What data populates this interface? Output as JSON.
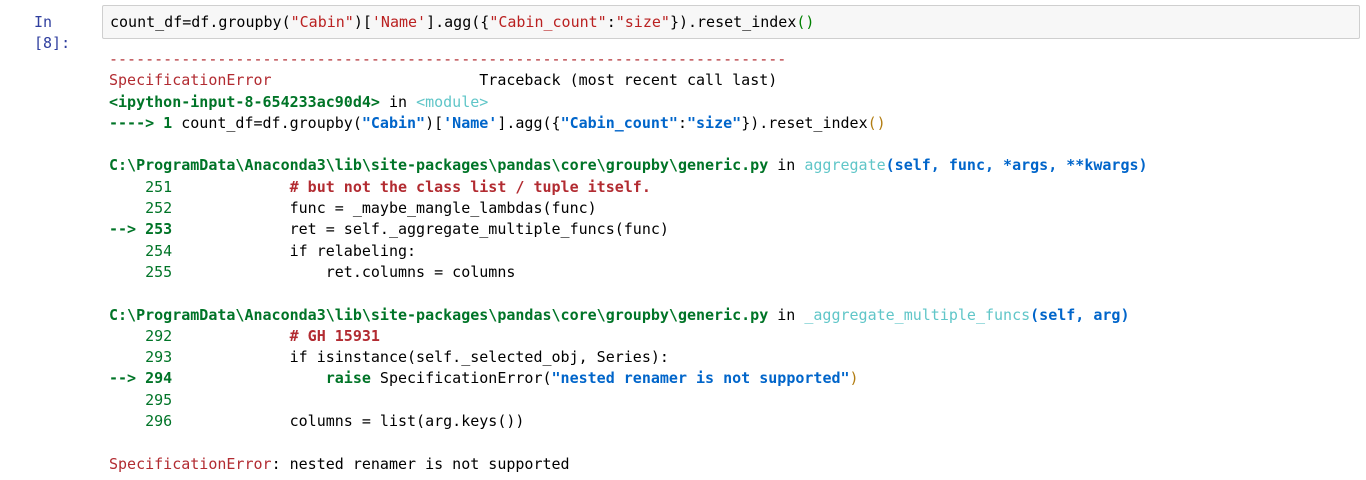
{
  "cell": {
    "prompt": "In [8]:",
    "input": {
      "p1": "count_df=df.groupby(",
      "s1": "\"Cabin\"",
      "p2": ")[",
      "s2": "'Name'",
      "p3": "].agg({",
      "s3": "\"Cabin_count\"",
      "p4": ":",
      "s4": "\"size\"",
      "p5": "}).reset_index",
      "p6": "()"
    }
  },
  "traceback": {
    "dashes": "---------------------------------------------------------------------------",
    "error_name": "SpecificationError",
    "header_gap": "                       ",
    "header_right": "Traceback (most recent call last)",
    "input_ref": "<ipython-input-8-654233ac90d4>",
    "in_word": " in ",
    "module": "<module>",
    "arrow_line_prefix": "----> 1 ",
    "arrow_code_a": "count_df=df.groupby(",
    "arrow_code_s1": "\"Cabin\"",
    "arrow_code_b": ")[",
    "arrow_code_s2": "'Name'",
    "arrow_code_c": "].agg({",
    "arrow_code_s3": "\"Cabin_count\"",
    "arrow_code_d": ":",
    "arrow_code_s4": "\"size\"",
    "arrow_code_e": "}).reset_index",
    "arrow_code_f": "()",
    "frame1": {
      "path": "C:\\ProgramData\\Anaconda3\\lib\\site-packages\\pandas\\core\\groupby\\generic.py",
      "in_word": " in ",
      "func": "aggregate",
      "args": "(self, func, *args, **kwargs)",
      "l251_no": "    251 ",
      "l251_code": "            # but not the class list / tuple itself.",
      "l252_no": "    252 ",
      "l252_code": "            func = _maybe_mangle_lambdas(func)",
      "l253_no": "--> 253 ",
      "l253_code": "            ret = self._aggregate_multiple_funcs(func)",
      "l254_no": "    254 ",
      "l254_code": "            if relabeling:",
      "l255_no": "    255 ",
      "l255_code": "                ret.columns = columns"
    },
    "frame2": {
      "path": "C:\\ProgramData\\Anaconda3\\lib\\site-packages\\pandas\\core\\groupby\\generic.py",
      "in_word": " in ",
      "func": "_aggregate_multiple_funcs",
      "args": "(self, arg)",
      "l292_no": "    292 ",
      "l292_code": "            # GH 15931",
      "l293_no": "    293 ",
      "l293_code": "            if isinstance(self._selected_obj, Series):",
      "l294_no": "--> 294 ",
      "l294_kw": "                raise",
      "l294_mid": " SpecificationError(",
      "l294_str": "\"nested renamer is not supported\"",
      "l294_end": ")",
      "l295_no": "    295 ",
      "l296_no": "    296 ",
      "l296_code": "            columns = list(arg.keys())"
    },
    "final_error": "SpecificationError",
    "final_message": ": nested renamer is not supported"
  }
}
